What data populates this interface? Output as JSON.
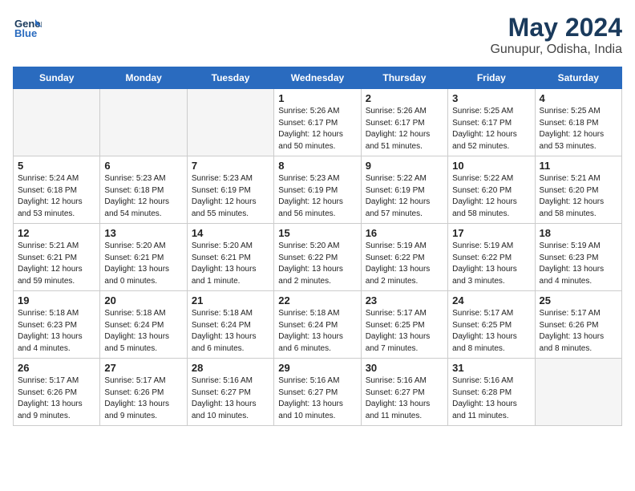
{
  "header": {
    "logo_line1": "General",
    "logo_line2": "Blue",
    "month": "May 2024",
    "location": "Gunupur, Odisha, India"
  },
  "weekdays": [
    "Sunday",
    "Monday",
    "Tuesday",
    "Wednesday",
    "Thursday",
    "Friday",
    "Saturday"
  ],
  "weeks": [
    [
      {
        "day": "",
        "info": ""
      },
      {
        "day": "",
        "info": ""
      },
      {
        "day": "",
        "info": ""
      },
      {
        "day": "1",
        "info": "Sunrise: 5:26 AM\nSunset: 6:17 PM\nDaylight: 12 hours\nand 50 minutes."
      },
      {
        "day": "2",
        "info": "Sunrise: 5:26 AM\nSunset: 6:17 PM\nDaylight: 12 hours\nand 51 minutes."
      },
      {
        "day": "3",
        "info": "Sunrise: 5:25 AM\nSunset: 6:17 PM\nDaylight: 12 hours\nand 52 minutes."
      },
      {
        "day": "4",
        "info": "Sunrise: 5:25 AM\nSunset: 6:18 PM\nDaylight: 12 hours\nand 53 minutes."
      }
    ],
    [
      {
        "day": "5",
        "info": "Sunrise: 5:24 AM\nSunset: 6:18 PM\nDaylight: 12 hours\nand 53 minutes."
      },
      {
        "day": "6",
        "info": "Sunrise: 5:23 AM\nSunset: 6:18 PM\nDaylight: 12 hours\nand 54 minutes."
      },
      {
        "day": "7",
        "info": "Sunrise: 5:23 AM\nSunset: 6:19 PM\nDaylight: 12 hours\nand 55 minutes."
      },
      {
        "day": "8",
        "info": "Sunrise: 5:23 AM\nSunset: 6:19 PM\nDaylight: 12 hours\nand 56 minutes."
      },
      {
        "day": "9",
        "info": "Sunrise: 5:22 AM\nSunset: 6:19 PM\nDaylight: 12 hours\nand 57 minutes."
      },
      {
        "day": "10",
        "info": "Sunrise: 5:22 AM\nSunset: 6:20 PM\nDaylight: 12 hours\nand 58 minutes."
      },
      {
        "day": "11",
        "info": "Sunrise: 5:21 AM\nSunset: 6:20 PM\nDaylight: 12 hours\nand 58 minutes."
      }
    ],
    [
      {
        "day": "12",
        "info": "Sunrise: 5:21 AM\nSunset: 6:21 PM\nDaylight: 12 hours\nand 59 minutes."
      },
      {
        "day": "13",
        "info": "Sunrise: 5:20 AM\nSunset: 6:21 PM\nDaylight: 13 hours\nand 0 minutes."
      },
      {
        "day": "14",
        "info": "Sunrise: 5:20 AM\nSunset: 6:21 PM\nDaylight: 13 hours\nand 1 minute."
      },
      {
        "day": "15",
        "info": "Sunrise: 5:20 AM\nSunset: 6:22 PM\nDaylight: 13 hours\nand 2 minutes."
      },
      {
        "day": "16",
        "info": "Sunrise: 5:19 AM\nSunset: 6:22 PM\nDaylight: 13 hours\nand 2 minutes."
      },
      {
        "day": "17",
        "info": "Sunrise: 5:19 AM\nSunset: 6:22 PM\nDaylight: 13 hours\nand 3 minutes."
      },
      {
        "day": "18",
        "info": "Sunrise: 5:19 AM\nSunset: 6:23 PM\nDaylight: 13 hours\nand 4 minutes."
      }
    ],
    [
      {
        "day": "19",
        "info": "Sunrise: 5:18 AM\nSunset: 6:23 PM\nDaylight: 13 hours\nand 4 minutes."
      },
      {
        "day": "20",
        "info": "Sunrise: 5:18 AM\nSunset: 6:24 PM\nDaylight: 13 hours\nand 5 minutes."
      },
      {
        "day": "21",
        "info": "Sunrise: 5:18 AM\nSunset: 6:24 PM\nDaylight: 13 hours\nand 6 minutes."
      },
      {
        "day": "22",
        "info": "Sunrise: 5:18 AM\nSunset: 6:24 PM\nDaylight: 13 hours\nand 6 minutes."
      },
      {
        "day": "23",
        "info": "Sunrise: 5:17 AM\nSunset: 6:25 PM\nDaylight: 13 hours\nand 7 minutes."
      },
      {
        "day": "24",
        "info": "Sunrise: 5:17 AM\nSunset: 6:25 PM\nDaylight: 13 hours\nand 8 minutes."
      },
      {
        "day": "25",
        "info": "Sunrise: 5:17 AM\nSunset: 6:26 PM\nDaylight: 13 hours\nand 8 minutes."
      }
    ],
    [
      {
        "day": "26",
        "info": "Sunrise: 5:17 AM\nSunset: 6:26 PM\nDaylight: 13 hours\nand 9 minutes."
      },
      {
        "day": "27",
        "info": "Sunrise: 5:17 AM\nSunset: 6:26 PM\nDaylight: 13 hours\nand 9 minutes."
      },
      {
        "day": "28",
        "info": "Sunrise: 5:16 AM\nSunset: 6:27 PM\nDaylight: 13 hours\nand 10 minutes."
      },
      {
        "day": "29",
        "info": "Sunrise: 5:16 AM\nSunset: 6:27 PM\nDaylight: 13 hours\nand 10 minutes."
      },
      {
        "day": "30",
        "info": "Sunrise: 5:16 AM\nSunset: 6:27 PM\nDaylight: 13 hours\nand 11 minutes."
      },
      {
        "day": "31",
        "info": "Sunrise: 5:16 AM\nSunset: 6:28 PM\nDaylight: 13 hours\nand 11 minutes."
      },
      {
        "day": "",
        "info": ""
      }
    ]
  ]
}
